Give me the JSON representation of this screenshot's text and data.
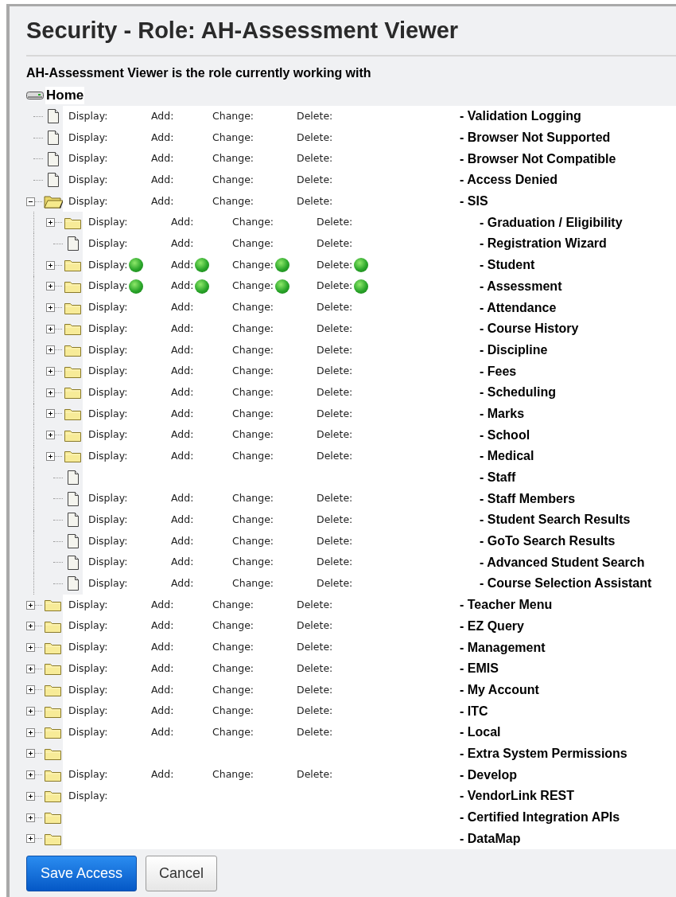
{
  "title": "Security - Role: AH-Assessment Viewer",
  "subtitle": "AH-Assessment Viewer is the role currently working with",
  "tree": {
    "label": "Home",
    "children": [
      {
        "name": "- Validation Logging",
        "kind": "page",
        "permissions": [
          {
            "label": "Display:",
            "granted": false
          },
          {
            "label": "Add:",
            "granted": false
          },
          {
            "label": "Change:",
            "granted": false
          },
          {
            "label": "Delete:",
            "granted": false
          }
        ]
      },
      {
        "name": "- Browser Not Supported",
        "kind": "page",
        "permissions": [
          {
            "label": "Display:",
            "granted": false
          },
          {
            "label": "Add:",
            "granted": false
          },
          {
            "label": "Change:",
            "granted": false
          },
          {
            "label": "Delete:",
            "granted": false
          }
        ]
      },
      {
        "name": "- Browser Not Compatible",
        "kind": "page",
        "permissions": [
          {
            "label": "Display:",
            "granted": false
          },
          {
            "label": "Add:",
            "granted": false
          },
          {
            "label": "Change:",
            "granted": false
          },
          {
            "label": "Delete:",
            "granted": false
          }
        ]
      },
      {
        "name": "- Access Denied",
        "kind": "page",
        "permissions": [
          {
            "label": "Display:",
            "granted": false
          },
          {
            "label": "Add:",
            "granted": false
          },
          {
            "label": "Change:",
            "granted": false
          },
          {
            "label": "Delete:",
            "granted": false
          }
        ]
      },
      {
        "name": "- SIS",
        "kind": "folder",
        "expanded": true,
        "permissions": [
          {
            "label": "Display:",
            "granted": false
          },
          {
            "label": "Add:",
            "granted": false
          },
          {
            "label": "Change:",
            "granted": false
          },
          {
            "label": "Delete:",
            "granted": false
          }
        ],
        "children": [
          {
            "name": "- Graduation / Eligibility",
            "kind": "folder",
            "expanded": false,
            "permissions": [
              {
                "label": "Display:",
                "granted": false
              },
              {
                "label": "Add:",
                "granted": false
              },
              {
                "label": "Change:",
                "granted": false
              },
              {
                "label": "Delete:",
                "granted": false
              }
            ]
          },
          {
            "name": "- Registration Wizard",
            "kind": "page",
            "permissions": [
              {
                "label": "Display:",
                "granted": false
              },
              {
                "label": "Add:",
                "granted": false
              },
              {
                "label": "Change:",
                "granted": false
              },
              {
                "label": "Delete:",
                "granted": false
              }
            ]
          },
          {
            "name": "- Student",
            "kind": "folder",
            "expanded": false,
            "permissions": [
              {
                "label": "Display:",
                "granted": true
              },
              {
                "label": "Add:",
                "granted": true
              },
              {
                "label": "Change:",
                "granted": true
              },
              {
                "label": "Delete:",
                "granted": true
              }
            ]
          },
          {
            "name": "- Assessment",
            "kind": "folder",
            "expanded": false,
            "permissions": [
              {
                "label": "Display:",
                "granted": true
              },
              {
                "label": "Add:",
                "granted": true
              },
              {
                "label": "Change:",
                "granted": true
              },
              {
                "label": "Delete:",
                "granted": true
              }
            ]
          },
          {
            "name": "- Attendance",
            "kind": "folder",
            "expanded": false,
            "permissions": [
              {
                "label": "Display:",
                "granted": false
              },
              {
                "label": "Add:",
                "granted": false
              },
              {
                "label": "Change:",
                "granted": false
              },
              {
                "label": "Delete:",
                "granted": false
              }
            ]
          },
          {
            "name": "- Course History",
            "kind": "folder",
            "expanded": false,
            "permissions": [
              {
                "label": "Display:",
                "granted": false
              },
              {
                "label": "Add:",
                "granted": false
              },
              {
                "label": "Change:",
                "granted": false
              },
              {
                "label": "Delete:",
                "granted": false
              }
            ]
          },
          {
            "name": "- Discipline",
            "kind": "folder",
            "expanded": false,
            "permissions": [
              {
                "label": "Display:",
                "granted": false
              },
              {
                "label": "Add:",
                "granted": false
              },
              {
                "label": "Change:",
                "granted": false
              },
              {
                "label": "Delete:",
                "granted": false
              }
            ]
          },
          {
            "name": "- Fees",
            "kind": "folder",
            "expanded": false,
            "permissions": [
              {
                "label": "Display:",
                "granted": false
              },
              {
                "label": "Add:",
                "granted": false
              },
              {
                "label": "Change:",
                "granted": false
              },
              {
                "label": "Delete:",
                "granted": false
              }
            ]
          },
          {
            "name": "- Scheduling",
            "kind": "folder",
            "expanded": false,
            "permissions": [
              {
                "label": "Display:",
                "granted": false
              },
              {
                "label": "Add:",
                "granted": false
              },
              {
                "label": "Change:",
                "granted": false
              },
              {
                "label": "Delete:",
                "granted": false
              }
            ]
          },
          {
            "name": "- Marks",
            "kind": "folder",
            "expanded": false,
            "permissions": [
              {
                "label": "Display:",
                "granted": false
              },
              {
                "label": "Add:",
                "granted": false
              },
              {
                "label": "Change:",
                "granted": false
              },
              {
                "label": "Delete:",
                "granted": false
              }
            ]
          },
          {
            "name": "- School",
            "kind": "folder",
            "expanded": false,
            "permissions": [
              {
                "label": "Display:",
                "granted": false
              },
              {
                "label": "Add:",
                "granted": false
              },
              {
                "label": "Change:",
                "granted": false
              },
              {
                "label": "Delete:",
                "granted": false
              }
            ]
          },
          {
            "name": "- Medical",
            "kind": "folder",
            "expanded": false,
            "permissions": [
              {
                "label": "Display:",
                "granted": false
              },
              {
                "label": "Add:",
                "granted": false
              },
              {
                "label": "Change:",
                "granted": false
              },
              {
                "label": "Delete:",
                "granted": false
              }
            ]
          },
          {
            "name": "- Staff",
            "kind": "page"
          },
          {
            "name": "- Staff Members",
            "kind": "page",
            "permissions": [
              {
                "label": "Display:",
                "granted": false
              },
              {
                "label": "Add:",
                "granted": false
              },
              {
                "label": "Change:",
                "granted": false
              },
              {
                "label": "Delete:",
                "granted": false
              }
            ]
          },
          {
            "name": "- Student Search Results",
            "kind": "page",
            "permissions": [
              {
                "label": "Display:",
                "granted": false
              },
              {
                "label": "Add:",
                "granted": false
              },
              {
                "label": "Change:",
                "granted": false
              },
              {
                "label": "Delete:",
                "granted": false
              }
            ]
          },
          {
            "name": "- GoTo Search Results",
            "kind": "page",
            "permissions": [
              {
                "label": "Display:",
                "granted": false
              },
              {
                "label": "Add:",
                "granted": false
              },
              {
                "label": "Change:",
                "granted": false
              },
              {
                "label": "Delete:",
                "granted": false
              }
            ]
          },
          {
            "name": "- Advanced Student Search",
            "kind": "page",
            "permissions": [
              {
                "label": "Display:",
                "granted": false
              },
              {
                "label": "Add:",
                "granted": false
              },
              {
                "label": "Change:",
                "granted": false
              },
              {
                "label": "Delete:",
                "granted": false
              }
            ]
          },
          {
            "name": "- Course Selection Assistant",
            "kind": "page",
            "permissions": [
              {
                "label": "Display:",
                "granted": false
              },
              {
                "label": "Add:",
                "granted": false
              },
              {
                "label": "Change:",
                "granted": false
              },
              {
                "label": "Delete:",
                "granted": false
              }
            ]
          }
        ]
      },
      {
        "name": "- Teacher Menu",
        "kind": "folder",
        "expanded": false,
        "permissions": [
          {
            "label": "Display:",
            "granted": false
          },
          {
            "label": "Add:",
            "granted": false
          },
          {
            "label": "Change:",
            "granted": false
          },
          {
            "label": "Delete:",
            "granted": false
          }
        ]
      },
      {
        "name": "- EZ Query",
        "kind": "folder",
        "expanded": false,
        "permissions": [
          {
            "label": "Display:",
            "granted": false
          },
          {
            "label": "Add:",
            "granted": false
          },
          {
            "label": "Change:",
            "granted": false
          },
          {
            "label": "Delete:",
            "granted": false
          }
        ]
      },
      {
        "name": "- Management",
        "kind": "folder",
        "expanded": false,
        "permissions": [
          {
            "label": "Display:",
            "granted": false
          },
          {
            "label": "Add:",
            "granted": false
          },
          {
            "label": "Change:",
            "granted": false
          },
          {
            "label": "Delete:",
            "granted": false
          }
        ]
      },
      {
        "name": "- EMIS",
        "kind": "folder",
        "expanded": false,
        "permissions": [
          {
            "label": "Display:",
            "granted": false
          },
          {
            "label": "Add:",
            "granted": false
          },
          {
            "label": "Change:",
            "granted": false
          },
          {
            "label": "Delete:",
            "granted": false
          }
        ]
      },
      {
        "name": "- My Account",
        "kind": "folder",
        "expanded": false,
        "permissions": [
          {
            "label": "Display:",
            "granted": false
          },
          {
            "label": "Add:",
            "granted": false
          },
          {
            "label": "Change:",
            "granted": false
          },
          {
            "label": "Delete:",
            "granted": false
          }
        ]
      },
      {
        "name": "- ITC",
        "kind": "folder",
        "expanded": false,
        "permissions": [
          {
            "label": "Display:",
            "granted": false
          },
          {
            "label": "Add:",
            "granted": false
          },
          {
            "label": "Change:",
            "granted": false
          },
          {
            "label": "Delete:",
            "granted": false
          }
        ]
      },
      {
        "name": "- Local",
        "kind": "folder",
        "expanded": false,
        "permissions": [
          {
            "label": "Display:",
            "granted": false
          },
          {
            "label": "Add:",
            "granted": false
          },
          {
            "label": "Change:",
            "granted": false
          },
          {
            "label": "Delete:",
            "granted": false
          }
        ]
      },
      {
        "name": "- Extra System Permissions",
        "kind": "folder",
        "expanded": false
      },
      {
        "name": "- Develop",
        "kind": "folder",
        "expanded": false,
        "permissions": [
          {
            "label": "Display:",
            "granted": false
          },
          {
            "label": "Add:",
            "granted": false
          },
          {
            "label": "Change:",
            "granted": false
          },
          {
            "label": "Delete:",
            "granted": false
          }
        ]
      },
      {
        "name": "- VendorLink REST",
        "kind": "folder",
        "expanded": false,
        "permissions": [
          {
            "label": "Display:",
            "granted": false
          }
        ]
      },
      {
        "name": "- Certified Integration APIs",
        "kind": "folder",
        "expanded": false
      },
      {
        "name": "- DataMap",
        "kind": "folder",
        "expanded": false
      }
    ]
  },
  "buttons": [
    {
      "label": "Save Access",
      "kind": "primary"
    },
    {
      "label": "Cancel",
      "kind": "secondary"
    }
  ]
}
